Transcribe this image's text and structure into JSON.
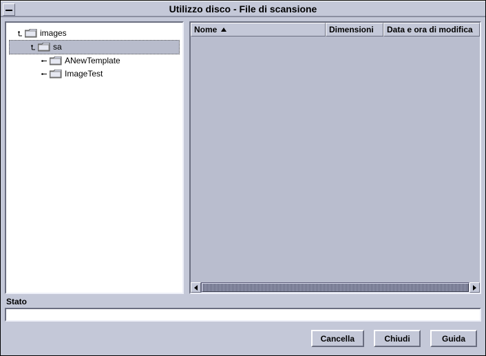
{
  "window": {
    "title": "Utilizzo disco - File di scansione"
  },
  "tree": {
    "root": {
      "label": "images",
      "expanded": true
    },
    "child_sa": {
      "label": "sa",
      "expanded": true,
      "selected": true
    },
    "leaves": [
      {
        "label": "ANewTemplate",
        "expanded": false
      },
      {
        "label": "ImageTest",
        "expanded": false
      }
    ]
  },
  "table": {
    "columns": [
      {
        "key": "name",
        "label": "Nome",
        "sorted": "asc"
      },
      {
        "key": "dimensions",
        "label": "Dimensioni"
      },
      {
        "key": "modified",
        "label": "Data e ora di modifica"
      }
    ],
    "rows": []
  },
  "status": {
    "label": "Stato",
    "value": ""
  },
  "buttons": {
    "cancel": "Cancella",
    "close": "Chiudi",
    "help": "Guida"
  }
}
